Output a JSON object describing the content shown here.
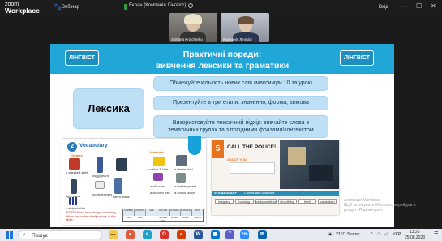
{
  "zoom_bar": {
    "logo_top": "zoom",
    "logo_bottom": "Workplace",
    "webinar_label": "Вебінар",
    "share_label": "Екран (Компанія Лінгвіст)",
    "signin_label": "Вхід",
    "icons": [
      "paw-icon",
      "minimize-icon",
      "maximize-icon",
      "close-icon"
    ]
  },
  "participants": [
    {
      "name": "Svitlana Kriucherko"
    },
    {
      "name": "Компанія Лінгвіст"
    }
  ],
  "slide": {
    "title_line1": "Практичні поради:",
    "title_line2": "вивчення лексики та граматики",
    "logo_text": "ЛІНГВІСТ",
    "logo_small": "ШКОЛА ІНОЗЕМНИХ МОВ",
    "section_label": "Лексика",
    "tips": [
      "Обмежуйте кількість нових слів (максимум 10 за урок)",
      "Презентуйте в три етапи: значення, форма, вимова",
      "Використовуйте лексичний підхід: вивчайте слова в тематичних групах та з похідними фразами/контекстом"
    ],
    "book_left": {
      "heading": "Vocabulary",
      "sub": "Clothes",
      "materials": "Materials",
      "items": [
        "a checked shirt",
        "baggy jeans",
        "a cotton T-shirt",
        "a denim skirt",
        "tight jeans",
        "a silk scarf",
        "a leather jacket",
        "a striped shirt",
        "sporty trainers",
        "flared jeans",
        "a woollen hat",
        "a cotton jacket"
      ],
      "note": "NOTE When describing something, follow the order of adjectives in the table.",
      "table_head": [
        "NUMBER",
        "OPINION",
        "SIZE",
        "COLOUR",
        "PATTERN",
        "MATERIAL",
        "NOUN"
      ],
      "table_row": [
        "Two",
        "nice",
        "red and white",
        "striped",
        "cotton",
        "T-shirts"
      ]
    },
    "book_right": {
      "unit": "5",
      "title": "CALL THE POLICE!",
      "about": "ABOUT YOU",
      "vocab": "VOCABULARY",
      "vocab_sub": "Crimes and criminals",
      "words": [
        "burglary",
        "hacking",
        "pickpocketing",
        "shoplifting",
        "theft",
        "vandalism"
      ]
    }
  },
  "activate_windows": {
    "line1": "Активація Windows",
    "line2": "Щоб активувати Windows, перейдіть в",
    "line3": "розділ «Параметри»."
  },
  "taskbar": {
    "search_placeholder": "Пошук",
    "weather": "21°C Sunny",
    "language": "УКР",
    "time": "13:26",
    "date": "25.08.2023",
    "apps": [
      "file-explorer-icon",
      "chrome-icon",
      "edge-icon",
      "opera-icon",
      "word-icon",
      "zoom-icon",
      "mail-icon",
      "store-icon",
      "teams-icon"
    ]
  }
}
